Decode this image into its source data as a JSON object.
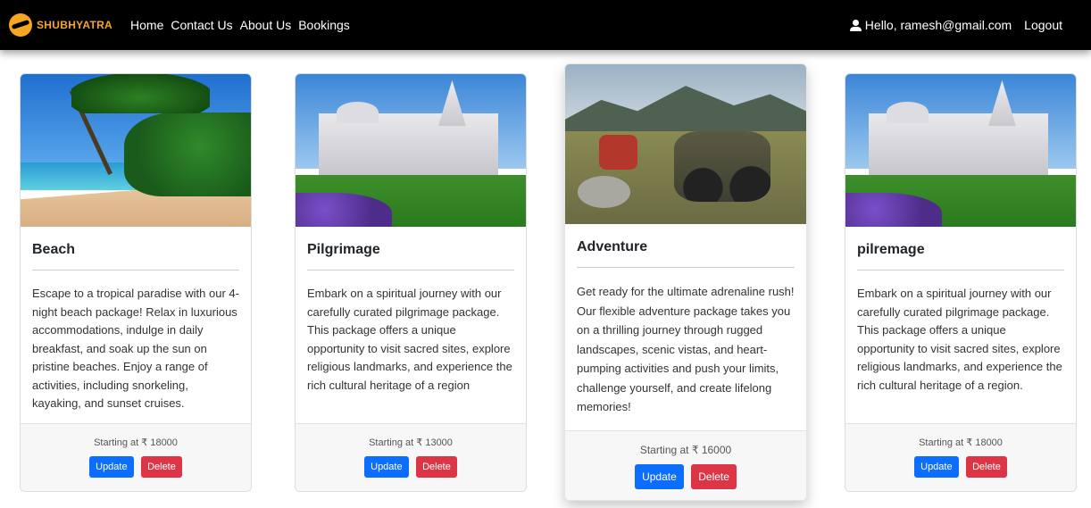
{
  "navbar": {
    "brand": "SHUBHYATRA",
    "links": [
      "Home",
      "Contact Us",
      "About Us",
      "Bookings"
    ],
    "greeting": "Hello, ramesh@gmail.com",
    "logout": "Logout"
  },
  "cards": [
    {
      "title": "Beach",
      "description": "Escape to a tropical paradise with our 4-night beach package! Relax in luxurious accommodations, indulge in daily breakfast, and soak up the sun on pristine beaches. Enjoy a range of activities, including snorkeling, kayaking, and sunset cruises.",
      "price": "Starting at ₹ 18000",
      "update_label": "Update",
      "delete_label": "Delete"
    },
    {
      "title": "Pilgrimage",
      "description": "Embark on a spiritual journey with our carefully curated pilgrimage package. This package offers a unique opportunity to visit sacred sites, explore religious landmarks, and experience the rich cultural heritage of a region",
      "price": "Starting at ₹ 13000",
      "update_label": "Update",
      "delete_label": "Delete"
    },
    {
      "title": "Adventure",
      "description": "Get ready for the ultimate adrenaline rush! Our flexible adventure package takes you on a thrilling journey through rugged landscapes, scenic vistas, and heart-pumping activities and push your limits, challenge yourself, and create lifelong memories!",
      "price": "Starting at ₹ 16000",
      "update_label": "Update",
      "delete_label": "Delete"
    },
    {
      "title": "pilremage",
      "description": "Embark on a spiritual journey with our carefully curated pilgrimage package. This package offers a unique opportunity to visit sacred sites, explore religious landmarks, and experience the rich cultural heritage of a region.",
      "price": "Starting at ₹ 18000",
      "update_label": "Update",
      "delete_label": "Delete"
    }
  ],
  "colors": {
    "navbar_bg": "#000000",
    "brand": "#f5a623",
    "update_button": "#0d6efd",
    "delete_button": "#dc3545"
  }
}
